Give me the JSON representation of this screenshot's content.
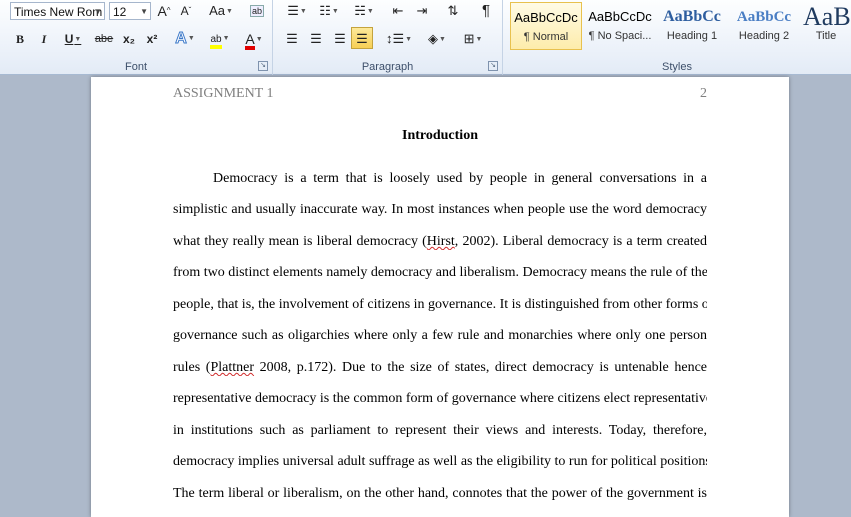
{
  "ribbon": {
    "font": {
      "label": "Font",
      "font_name": "Times New Rom",
      "font_size": "12",
      "grow_label": "A",
      "shrink_label": "A",
      "case_label": "Aa",
      "clear_label": "ab",
      "bold_label": "B",
      "italic_label": "I",
      "underline_label": "U",
      "strike_label": "abe",
      "subscript_label": "x₂",
      "superscript_label": "x²",
      "effects_label": "A",
      "highlight_label": "ab",
      "color_label": "A",
      "highlight_color": "#ffff00",
      "font_color": "#e00000"
    },
    "paragraph": {
      "label": "Paragraph",
      "pilcrow": "¶"
    },
    "styles": {
      "label": "Styles",
      "items": [
        {
          "preview": "AaBbCcDc",
          "name": "¶ Normal"
        },
        {
          "preview": "AaBbCcDc",
          "name": "¶ No Spaci..."
        },
        {
          "preview": "AaBbCc",
          "name": "Heading 1"
        },
        {
          "preview": "AaBbCc",
          "name": "Heading 2"
        },
        {
          "preview": "AaB",
          "name": "Title"
        }
      ]
    }
  },
  "document": {
    "header_left": "ASSIGNMENT 1",
    "page_number": "2",
    "heading": "Introduction",
    "lines": [
      "Democracy is a term that is loosely used by people in general conversations in a",
      "simplistic and usually inaccurate way. In most instances when people use the word democracy",
      "liberal democracy",
      "from two distinct elements namely democracy and liberalism. Democracy means the rule of the",
      "people, that is, the involvement of citizens in governance. It is distinguished from other forms of",
      "governance such as oligarchies where only a few rule and monarchies where only one person",
      "rules",
      "representative democracy is the common form of governance where citizens elect representatives",
      "in institutions such as parliament to represent their views and interests. Today, therefore,",
      "democracy implies universal adult suffrage as well as the eligibility to run for political positions.",
      "The term liberal or liberalism, on the other hand, connotes that the power of the government is"
    ],
    "line3_a": "what they really mean is liberal democracy (",
    "line3_cite": "Hirst",
    "line3_b": ", 2002). Liberal democracy is a term created",
    "line7_a": "rules (",
    "line7_cite": "Plattner",
    "line7_b": " 2008, p.172). Due to the size of states, direct democracy is untenable hence"
  }
}
